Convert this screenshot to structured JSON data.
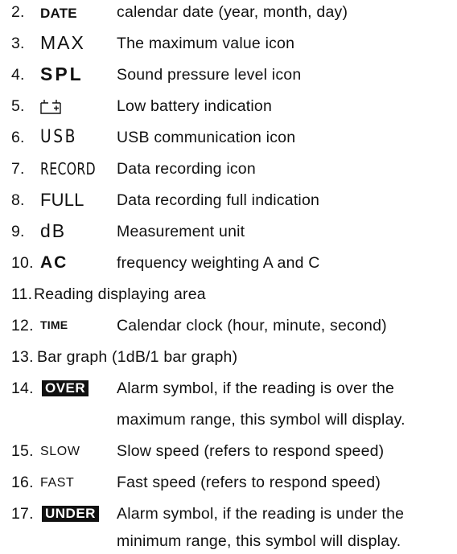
{
  "items": [
    {
      "num": "2.",
      "sym": "DATE",
      "desc": "calendar date (year, month, day)"
    },
    {
      "num": "3.",
      "sym": "MAX",
      "desc": "The maximum value icon"
    },
    {
      "num": "4.",
      "sym": "SPL",
      "desc": "Sound pressure level icon"
    },
    {
      "num": "5.",
      "icon": "battery-icon",
      "desc": "Low battery indication"
    },
    {
      "num": "6.",
      "sym": "USB",
      "desc": "USB communication icon"
    },
    {
      "num": "7.",
      "sym": "RECORD",
      "desc": "Data recording icon"
    },
    {
      "num": "8.",
      "sym": "FULL",
      "desc": "Data recording full indication"
    },
    {
      "num": "9.",
      "sym": "dB",
      "desc": "Measurement unit"
    },
    {
      "num": "10.",
      "sym": "AC",
      "desc": "frequency weighting A and C"
    },
    {
      "num": "11.",
      "desc": "Reading displaying area"
    },
    {
      "num": "12.",
      "sym": "TIME",
      "desc": "Calendar clock (hour, minute, second)"
    },
    {
      "num": "13.",
      "desc": "Bar graph (1dB/1 bar graph)"
    },
    {
      "num": "14.",
      "sym": "OVER",
      "desc": "Alarm symbol, if the reading is over the",
      "desc2": "maximum range, this symbol will display."
    },
    {
      "num": "15.",
      "sym": "SLOW",
      "desc": "Slow speed (refers to respond speed)"
    },
    {
      "num": "16.",
      "sym": "FAST",
      "desc": "Fast speed (refers to respond speed)"
    },
    {
      "num": "17.",
      "sym": "UNDER",
      "desc": "Alarm symbol, if the reading is under the",
      "desc2": "minimum range, this symbol will display."
    }
  ]
}
